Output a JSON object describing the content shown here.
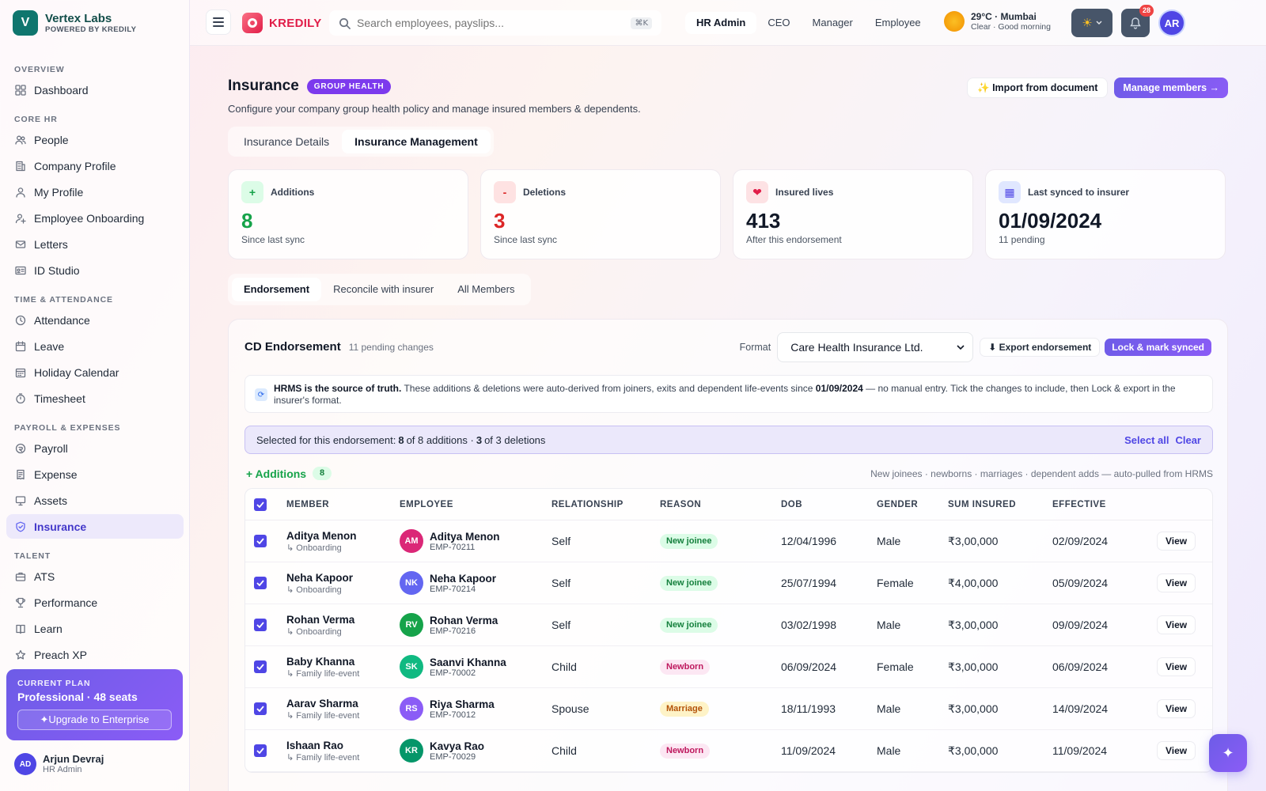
{
  "brand": {
    "initial": "V",
    "name": "Vertex Labs",
    "sub": "POWERED BY KREDILY"
  },
  "sidebar": {
    "sections": [
      {
        "title": "OVERVIEW",
        "items": [
          {
            "label": "Dashboard",
            "icon": "grid-icon"
          }
        ]
      },
      {
        "title": "CORE HR",
        "items": [
          {
            "label": "People",
            "icon": "users-icon"
          },
          {
            "label": "Company Profile",
            "icon": "building-icon"
          },
          {
            "label": "My Profile",
            "icon": "user-icon"
          },
          {
            "label": "Employee Onboarding",
            "icon": "user-plus-icon"
          },
          {
            "label": "Letters",
            "icon": "mail-icon"
          },
          {
            "label": "ID Studio",
            "icon": "id-card-icon"
          }
        ]
      },
      {
        "title": "TIME & ATTENDANCE",
        "items": [
          {
            "label": "Attendance",
            "icon": "clock-icon"
          },
          {
            "label": "Leave",
            "icon": "calendar-icon"
          },
          {
            "label": "Holiday Calendar",
            "icon": "calendar-days-icon"
          },
          {
            "label": "Timesheet",
            "icon": "timer-icon"
          }
        ]
      },
      {
        "title": "PAYROLL & EXPENSES",
        "items": [
          {
            "label": "Payroll",
            "icon": "coin-icon"
          },
          {
            "label": "Expense",
            "icon": "receipt-icon"
          },
          {
            "label": "Assets",
            "icon": "monitor-icon"
          },
          {
            "label": "Insurance",
            "icon": "shield-icon",
            "active": true
          }
        ]
      },
      {
        "title": "TALENT",
        "items": [
          {
            "label": "ATS",
            "icon": "briefcase-icon"
          },
          {
            "label": "Performance",
            "icon": "trophy-icon"
          },
          {
            "label": "Learn",
            "icon": "book-icon"
          },
          {
            "label": "Preach XP",
            "icon": "star-icon"
          }
        ]
      }
    ]
  },
  "plan": {
    "label": "CURRENT PLAN",
    "name": "Professional · 48 seats",
    "upgrade": "✦Upgrade to Enterprise"
  },
  "user": {
    "initials": "AD",
    "name": "Arjun Devraj",
    "role": "HR Admin"
  },
  "topbar": {
    "logo_text": "KREDILY",
    "search_placeholder": "Search employees, payslips...",
    "shortcut": "⌘K",
    "roles": [
      {
        "label": "HR Admin",
        "active": true
      },
      {
        "label": "CEO"
      },
      {
        "label": "Manager"
      },
      {
        "label": "Employee"
      }
    ],
    "weather_main": "29°C · Mumbai",
    "weather_sub": "Clear · Good morning",
    "notifications": "28",
    "avatar": "AR"
  },
  "page": {
    "title": "Insurance",
    "badge": "GROUP HEALTH",
    "subtitle": "Configure your company group health policy and manage insured members & dependents.",
    "import_label": "✨ Import from document",
    "manage_label": "Manage members →",
    "tabs": [
      {
        "label": "Insurance Details"
      },
      {
        "label": "Insurance Management",
        "active": true
      }
    ]
  },
  "stats": [
    {
      "icon": "+",
      "label": "Additions",
      "value": "8",
      "sub": "Since last sync",
      "color": "#16a34a",
      "bg": "#dcfce7"
    },
    {
      "icon": "-",
      "label": "Deletions",
      "value": "3",
      "sub": "Since last sync",
      "color": "#dc2626",
      "bg": "#fee2e2"
    },
    {
      "icon": "❤",
      "label": "Insured lives",
      "value": "413",
      "sub": "After this endorsement",
      "color": "#111827",
      "bg": "#fde2e4"
    },
    {
      "icon": "▦",
      "label": "Last synced to insurer",
      "value": "01/09/2024",
      "sub": "11 pending",
      "color": "#111827",
      "bg": "#e0e7ff"
    }
  ],
  "subtabs": [
    {
      "label": "Endorsement",
      "active": true
    },
    {
      "label": "Reconcile with insurer"
    },
    {
      "label": "All Members"
    }
  ],
  "endorsement": {
    "title": "CD Endorsement",
    "pending": "11 pending changes",
    "format_label": "Format",
    "format_value": "Care Health Insurance Ltd.",
    "export_label": "⬇ Export endorsement",
    "lock_label": "Lock & mark synced",
    "info_bold": "HRMS is the source of truth.",
    "info_text1": " These additions & deletions were auto-derived from joiners, exits and dependent life-events since ",
    "info_date": "01/09/2024",
    "info_text2": " — no manual entry. Tick the changes to include, then Lock & export in the insurer's format.",
    "sel_prefix": "Selected for this endorsement:",
    "sel_add_n": "8",
    "sel_add_text": "of 8 additions ·",
    "sel_del_n": "3",
    "sel_del_text": "of 3 deletions",
    "select_all": "Select all",
    "clear": "Clear",
    "additions_title": "+ Additions",
    "additions_count": "8",
    "additions_hint": "New joinees · newborns · marriages · dependent adds — auto-pulled from HRMS"
  },
  "table": {
    "headers": [
      "MEMBER",
      "EMPLOYEE",
      "RELATIONSHIP",
      "REASON",
      "DOB",
      "GENDER",
      "SUM INSURED",
      "EFFECTIVE"
    ],
    "rows": [
      {
        "member": "Aditya Menon",
        "source": "↳ Onboarding",
        "emp_initials": "AM",
        "emp_color": "#db2777",
        "emp_name": "Aditya Menon",
        "emp_id": "EMP-70211",
        "relationship": "Self",
        "reason": "New joinee",
        "tag": "green",
        "dob": "12/04/1996",
        "gender": "Male",
        "sum": "₹3,00,000",
        "effective": "02/09/2024",
        "action": "View"
      },
      {
        "member": "Neha Kapoor",
        "source": "↳ Onboarding",
        "emp_initials": "NK",
        "emp_color": "#6366f1",
        "emp_name": "Neha Kapoor",
        "emp_id": "EMP-70214",
        "relationship": "Self",
        "reason": "New joinee",
        "tag": "green",
        "dob": "25/07/1994",
        "gender": "Female",
        "sum": "₹4,00,000",
        "effective": "05/09/2024",
        "action": "View"
      },
      {
        "member": "Rohan Verma",
        "source": "↳ Onboarding",
        "emp_initials": "RV",
        "emp_color": "#16a34a",
        "emp_name": "Rohan Verma",
        "emp_id": "EMP-70216",
        "relationship": "Self",
        "reason": "New joinee",
        "tag": "green",
        "dob": "03/02/1998",
        "gender": "Male",
        "sum": "₹3,00,000",
        "effective": "09/09/2024",
        "action": "View"
      },
      {
        "member": "Baby Khanna",
        "source": "↳ Family life-event",
        "emp_initials": "SK",
        "emp_color": "#10b981",
        "emp_name": "Saanvi Khanna",
        "emp_id": "EMP-70002",
        "relationship": "Child",
        "reason": "Newborn",
        "tag": "pink",
        "dob": "06/09/2024",
        "gender": "Female",
        "sum": "₹3,00,000",
        "effective": "06/09/2024",
        "action": "View"
      },
      {
        "member": "Aarav Sharma",
        "source": "↳ Family life-event",
        "emp_initials": "RS",
        "emp_color": "#8b5cf6",
        "emp_name": "Riya Sharma",
        "emp_id": "EMP-70012",
        "relationship": "Spouse",
        "reason": "Marriage",
        "tag": "amber",
        "dob": "18/11/1993",
        "gender": "Male",
        "sum": "₹3,00,000",
        "effective": "14/09/2024",
        "action": "View"
      },
      {
        "member": "Ishaan Rao",
        "source": "↳ Family life-event",
        "emp_initials": "KR",
        "emp_color": "#059669",
        "emp_name": "Kavya Rao",
        "emp_id": "EMP-70029",
        "relationship": "Child",
        "reason": "Newborn",
        "tag": "pink",
        "dob": "11/09/2024",
        "gender": "Male",
        "sum": "₹3,00,000",
        "effective": "11/09/2024",
        "action": "View"
      }
    ]
  },
  "fab_icon": "✦"
}
